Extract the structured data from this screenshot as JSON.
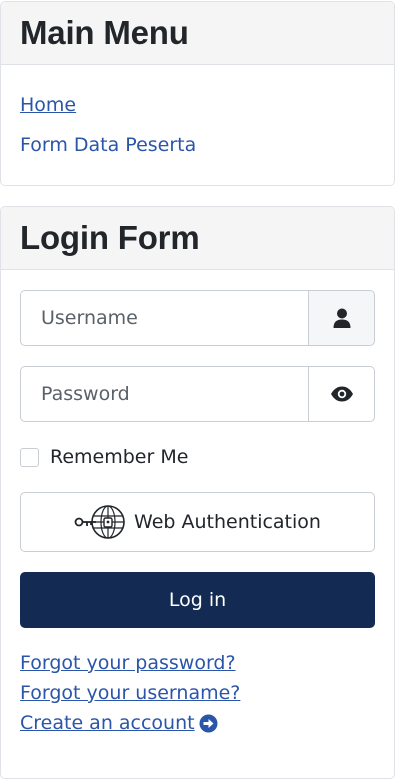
{
  "main_menu": {
    "title": "Main Menu",
    "items": [
      {
        "label": "Home"
      },
      {
        "label": "Form Data Peserta"
      }
    ]
  },
  "login_form": {
    "title": "Login Form",
    "username": {
      "placeholder": "Username",
      "value": "",
      "icon": "user-icon"
    },
    "password": {
      "placeholder": "Password",
      "value": "",
      "icon": "eye-icon"
    },
    "remember_label": "Remember Me",
    "webauthn_label": "Web Authentication",
    "login_label": "Log in",
    "links": {
      "forgot_password": "Forgot your password?",
      "forgot_username": "Forgot your username?",
      "create_account": "Create an account"
    }
  },
  "colors": {
    "link": "#2a55a8",
    "primary_button": "#132a52",
    "header_bg": "#f5f5f6"
  }
}
